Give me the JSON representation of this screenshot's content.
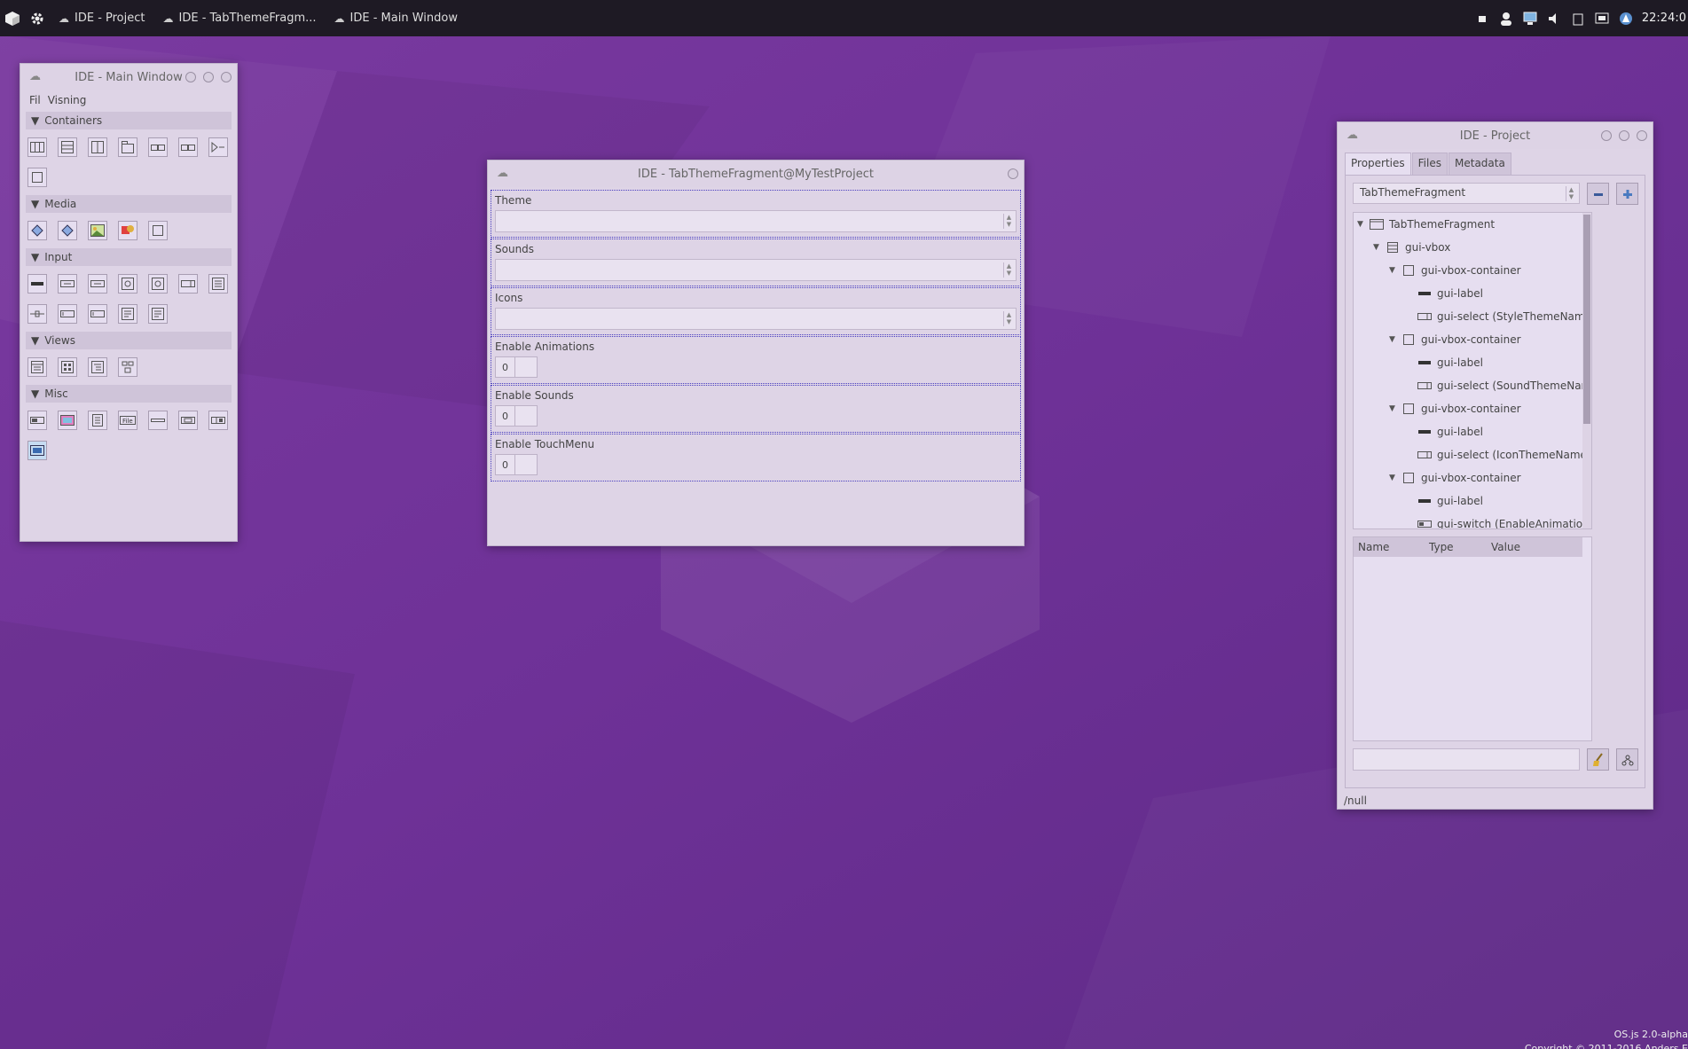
{
  "panel": {
    "windows": [
      {
        "label": "IDE - Project"
      },
      {
        "label": "IDE - TabThemeFragm..."
      },
      {
        "label": "IDE - Main Window"
      }
    ],
    "clock": "22:24:0"
  },
  "main_window": {
    "title": "IDE - Main Window",
    "menu": [
      "Fil",
      "Visning"
    ],
    "sections": [
      {
        "label": "Containers"
      },
      {
        "label": "Media"
      },
      {
        "label": "Input"
      },
      {
        "label": "Views"
      },
      {
        "label": "Misc"
      }
    ]
  },
  "form_window": {
    "title": "IDE - TabThemeFragment@MyTestProject",
    "fields": [
      {
        "label": "Theme",
        "value": ""
      },
      {
        "label": "Sounds",
        "value": ""
      },
      {
        "label": "Icons",
        "value": ""
      },
      {
        "label": "Enable Animations",
        "value": "0"
      },
      {
        "label": "Enable Sounds",
        "value": "0"
      },
      {
        "label": "Enable TouchMenu",
        "value": "0"
      }
    ]
  },
  "project_window": {
    "title": "IDE - Project",
    "tabs": [
      "Properties",
      "Files",
      "Metadata"
    ],
    "selected": "TabThemeFragment",
    "tree": [
      {
        "label": "TabThemeFragment",
        "icon": "window-icon"
      },
      {
        "label": "gui-vbox",
        "icon": "vbox-icon"
      },
      {
        "label": "gui-vbox-container",
        "icon": "container-icon"
      },
      {
        "label": "gui-label",
        "icon": "label-icon"
      },
      {
        "label": "gui-select (StyleThemeName)",
        "icon": "select-icon"
      },
      {
        "label": "gui-vbox-container",
        "icon": "container-icon"
      },
      {
        "label": "gui-label",
        "icon": "label-icon"
      },
      {
        "label": "gui-select (SoundThemeName)",
        "icon": "select-icon"
      },
      {
        "label": "gui-vbox-container",
        "icon": "container-icon"
      },
      {
        "label": "gui-label",
        "icon": "label-icon"
      },
      {
        "label": "gui-select (IconThemeName)",
        "icon": "select-icon"
      },
      {
        "label": "gui-vbox-container",
        "icon": "container-icon"
      },
      {
        "label": "gui-label",
        "icon": "label-icon"
      },
      {
        "label": "gui-switch (EnableAnimations)",
        "icon": "switch-icon"
      }
    ],
    "props_columns": [
      "Name",
      "Type",
      "Value"
    ],
    "status": "/null"
  },
  "footer": {
    "line1": "OS.js 2.0-alpha",
    "line2": "Copyright © 2011-2016 Anders E"
  },
  "colors": {
    "desktop": "#6b2f96",
    "panel": "#1e1a24",
    "window": "#ded4e6",
    "accent_border": "#4a3fbf"
  }
}
